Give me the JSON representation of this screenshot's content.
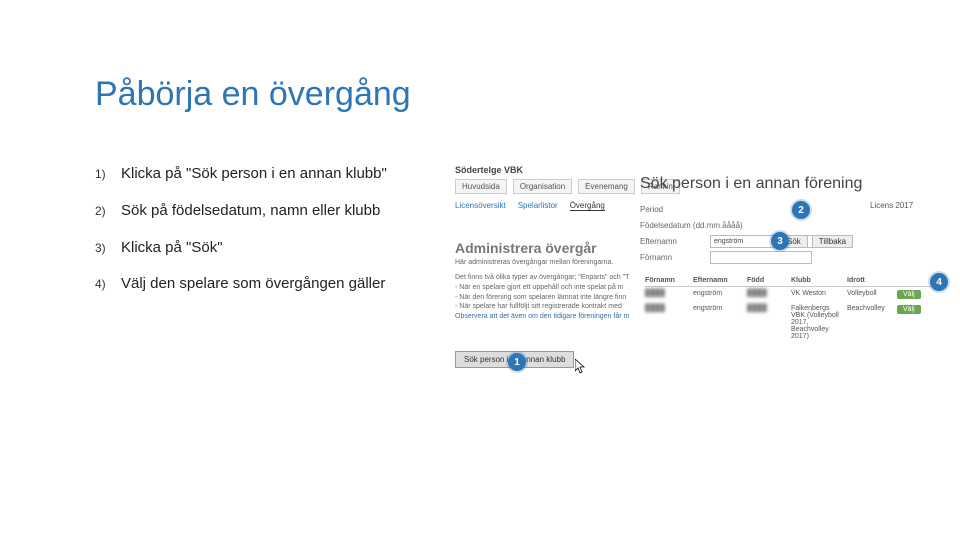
{
  "title": "Påbörja en övergång",
  "steps": [
    {
      "num": "1)",
      "text": "Klicka på \"Sök person i en annan klubb\""
    },
    {
      "num": "2)",
      "text": "Sök på födelsedatum, namn eller klubb"
    },
    {
      "num": "3)",
      "text": "Klicka på \"Sök\""
    },
    {
      "num": "4)",
      "text": "Välj den spelare som övergången gäller"
    }
  ],
  "shot": {
    "org": "Södertelge VBK",
    "tabs1": [
      "Huvudsida",
      "Organisation",
      "Evenemang",
      "Rankin"
    ],
    "bigtitle": "Sök person i en annan förening",
    "tabs2": [
      "Licensöversikt",
      "Spelarlistor",
      "Övergång"
    ],
    "form": {
      "period_lbl": "Period",
      "birth_lbl": "Födelsedatum (dd.mm.åååå)",
      "lastname_lbl": "Efternamn",
      "firstname_lbl": "Förnamn",
      "lastname_val": "engström"
    },
    "lic": "Licens 2017",
    "btn_search": "Sök",
    "btn_back": "Tillbaka",
    "admin": "Administrera övergår",
    "adminsub": "Här administreras övergångar mellan föreningarna.",
    "bullets": [
      "Det finns två olika typer av övergångar; \"Enparts\" och \"T",
      "- När en spelare gjort ett uppehåll och inte spelat på m",
      "- När den förening som spelaren lämnat inte längre finn",
      "- När spelare har fullföljt sitt registrerade kontrakt med"
    ],
    "obs": "Observera att det även om den tidigare föreningen får m",
    "searchbtn": "Sök person i en annan klubb",
    "thead": [
      "Förnamn",
      "Efternamn",
      "Född",
      "Klubb",
      "Idrott"
    ],
    "rows": [
      {
        "fn": "████",
        "ln": "engström",
        "dob": "████",
        "club": "VK Weston",
        "sport": "Volleyboll",
        "valj": "Välj"
      },
      {
        "fn": "████",
        "ln": "engström",
        "dob": "████",
        "club": "Falkenbergs VBK (Volleyboll 2017, Beachvolley 2017)",
        "sport": "Beachvolley",
        "valj": "Välj"
      }
    ],
    "markers": {
      "m1": "1",
      "m2": "2",
      "m3": "3",
      "m4": "4"
    }
  }
}
